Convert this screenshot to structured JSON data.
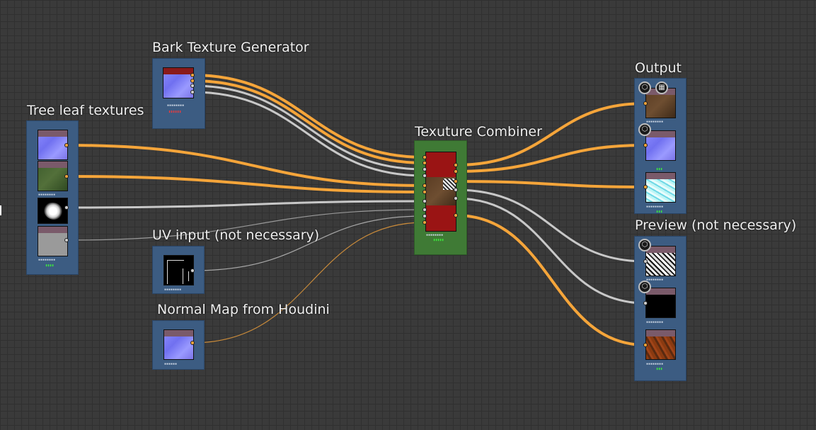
{
  "frames": {
    "bark": "Bark Texture Generator",
    "tree_leaf": "Tree leaf textures",
    "combiner": "Texuture Combiner",
    "uv": "UV input (not necessary)",
    "normal": "Normal Map from Houdini",
    "output": "Output",
    "preview": "Preview (not necessary)"
  },
  "colors": {
    "wire_orange": "#f5a53a",
    "wire_gray": "#c8c8c8",
    "frame_blue": "#3c5c82",
    "frame_green": "#3f7a35",
    "status_green": "#3cf03c",
    "status_red": "#ff3a3a"
  },
  "icons": {
    "output_badge": "cube-icon",
    "output_badge_2": "grid-icon"
  }
}
